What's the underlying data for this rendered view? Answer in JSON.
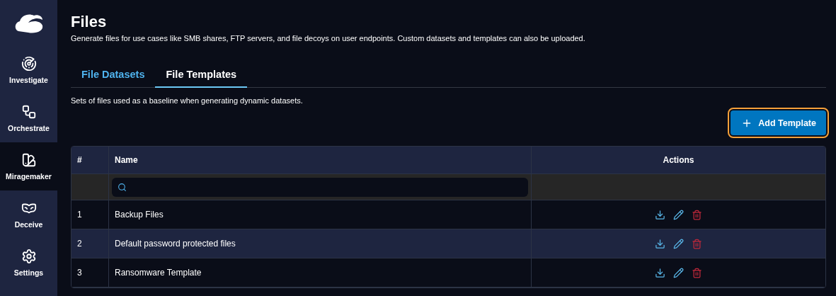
{
  "sidebar": {
    "items": [
      {
        "label": "Investigate",
        "selected": false
      },
      {
        "label": "Orchestrate",
        "selected": false
      },
      {
        "label": "Miragemaker",
        "selected": true
      },
      {
        "label": "Deceive",
        "selected": false
      },
      {
        "label": "Settings",
        "selected": false
      }
    ]
  },
  "page": {
    "title": "Files",
    "subtitle": "Generate files for use cases like SMB shares, FTP servers, and file decoys on user endpoints. Custom datasets and templates can also be uploaded."
  },
  "tabs": [
    {
      "label": "File Datasets",
      "selected": false
    },
    {
      "label": "File Templates",
      "selected": true
    }
  ],
  "description": "Sets of files used as a baseline when generating dynamic datasets.",
  "add_button": {
    "label": "Add Template",
    "focused": true
  },
  "table": {
    "columns": [
      "#",
      "Name",
      "Actions"
    ],
    "rows": [
      {
        "index": "1",
        "name": "Backup Files"
      },
      {
        "index": "2",
        "name": "Default password protected files"
      },
      {
        "index": "3",
        "name": "Ransomware Template"
      }
    ]
  }
}
